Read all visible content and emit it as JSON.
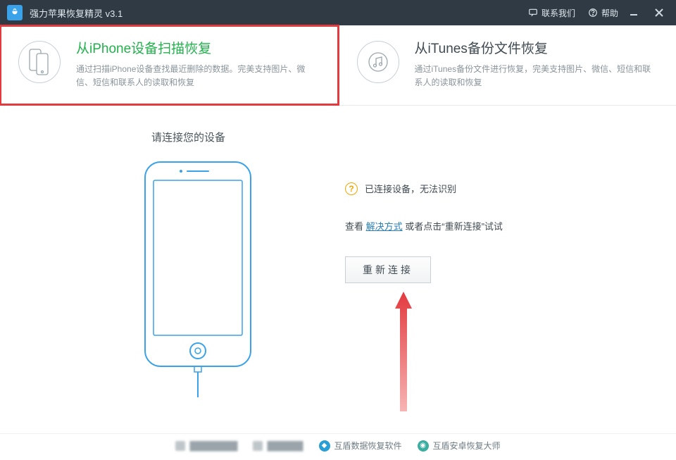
{
  "titlebar": {
    "app_title": "强力苹果恢复精灵 v3.1",
    "contact_label": "联系我们",
    "help_label": "帮助"
  },
  "modes": {
    "iphone": {
      "heading": "从iPhone设备扫描恢复",
      "desc": "通过扫描iPhone设备查找最近删除的数据。完美支持图片、微信、短信和联系人的读取和恢复"
    },
    "itunes": {
      "heading": "从iTunes备份文件恢复",
      "desc": "通过iTunes备份文件进行恢复，完美支持图片、微信、短信和联系人的读取和恢复"
    }
  },
  "content": {
    "prompt": "请连接您的设备",
    "status": "已连接设备，无法识别",
    "hint_prefix": "查看 ",
    "hint_link": "解决方式",
    "hint_mid": " 或者点击“重新连接”试试",
    "reconnect": "重新连接"
  },
  "footer": {
    "link1": "互盾数据恢复软件",
    "link2": "互盾安卓恢复大师"
  }
}
